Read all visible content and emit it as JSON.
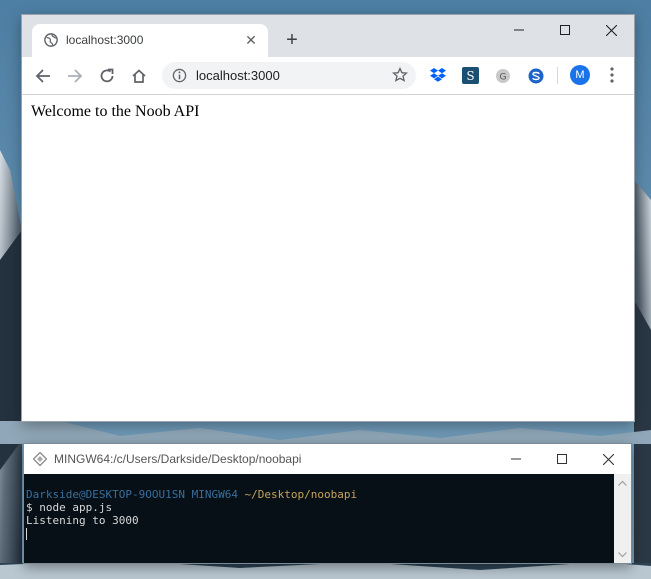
{
  "browser": {
    "tab": {
      "title": "localhost:3000",
      "favicon": "globe-icon",
      "close": "close-icon"
    },
    "new_tab": "+",
    "window_controls": [
      "minimize-icon",
      "maximize-icon",
      "close-icon"
    ],
    "toolbar": {
      "back": "back-arrow-icon",
      "forward": "forward-arrow-icon",
      "reload": "reload-icon",
      "home": "home-icon",
      "url": "localhost:3000",
      "bookmark": "star-icon",
      "extensions": [
        "dropbox-icon",
        "stylus-icon",
        "grammarly-icon",
        "stream-icon"
      ],
      "avatar_initial": "M",
      "menu": "kebab-menu-icon"
    },
    "page": {
      "text": "Welcome to the Noob API"
    }
  },
  "terminal": {
    "title": "MINGW64:/c/Users/Darkside/Desktop/noobapi",
    "prompt": {
      "user": "Darkside@DESKTOP-9OOU1SN",
      "system": "MINGW64",
      "path": "~/Desktop/noobapi"
    },
    "lines": [
      "$ node app.js",
      "Listening to 3000"
    ]
  },
  "colors": {
    "chrome_tabstrip": "#dee1e6",
    "omnibox": "#f1f3f4",
    "terminal_bg": "#061016",
    "prompt_blue": "#3a6e9c",
    "prompt_path": "#c8a35a",
    "avatar": "#1a73e8"
  }
}
